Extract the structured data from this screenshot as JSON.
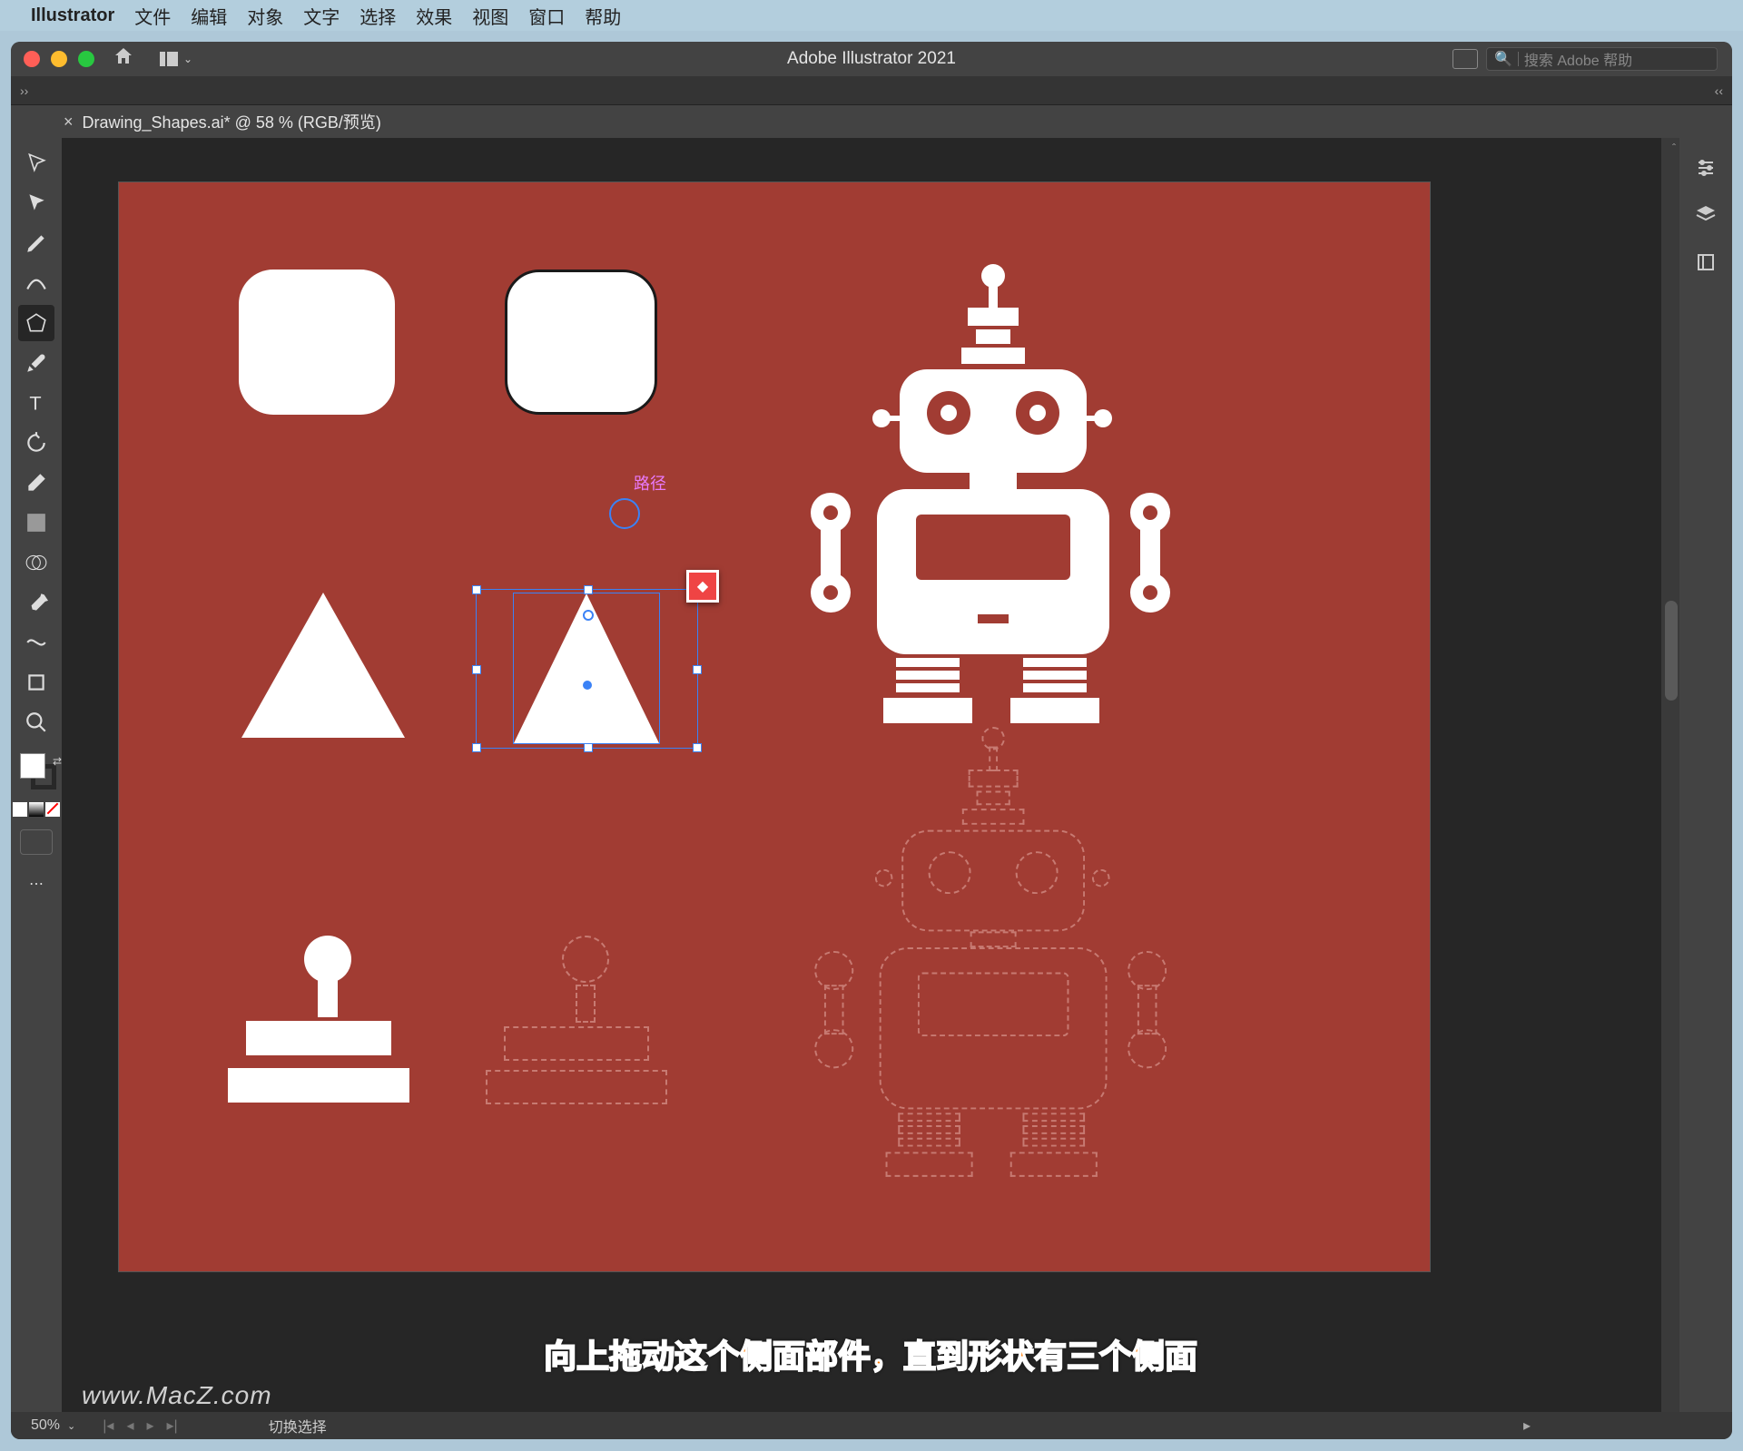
{
  "menubar": {
    "appname": "Illustrator",
    "items": [
      "文件",
      "编辑",
      "对象",
      "文字",
      "选择",
      "效果",
      "视图",
      "窗口",
      "帮助"
    ]
  },
  "window": {
    "title": "Adobe Illustrator 2021",
    "search_placeholder": "搜索 Adobe 帮助"
  },
  "tab": {
    "label": "Drawing_Shapes.ai* @ 58 % (RGB/预览)"
  },
  "canvas": {
    "anchor_label": "路径"
  },
  "statusbar": {
    "zoom": "50%",
    "mode": "切换选择"
  },
  "caption": "向上拖动这个侧面部件，直到形状有三个侧面",
  "watermark": "www.MacZ.com",
  "colors": {
    "artboard": "#a13c33",
    "selection": "#3b82f6",
    "widget": "#ef4444"
  }
}
